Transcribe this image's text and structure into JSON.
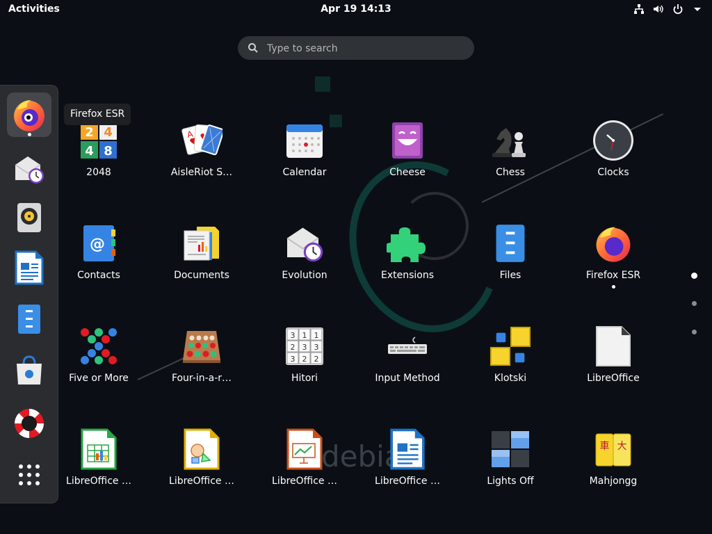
{
  "topbar": {
    "activities": "Activities",
    "clock": "Apr 19  14:13",
    "tray": [
      "network-icon",
      "volume-icon",
      "power-icon",
      "menu-arrow-icon"
    ]
  },
  "search": {
    "placeholder": "Type to search"
  },
  "dash": {
    "items": [
      {
        "name": "firefox-esr",
        "icon": "firefox-icon",
        "active": true,
        "running": true
      },
      {
        "name": "evolution",
        "icon": "evolution-icon"
      },
      {
        "name": "rhythmbox",
        "icon": "rhythmbox-icon"
      },
      {
        "name": "libreoffice-writer",
        "icon": "libreoffice-writer-icon"
      },
      {
        "name": "files",
        "icon": "files-icon"
      },
      {
        "name": "software",
        "icon": "software-icon"
      },
      {
        "name": "help",
        "icon": "help-icon"
      },
      {
        "name": "show-applications",
        "icon": "app-grid-icon"
      }
    ]
  },
  "tooltip": "Firefox ESR",
  "apps": [
    {
      "label": "2048",
      "icon": "2048-icon"
    },
    {
      "label": "AisleRiot S…",
      "icon": "cards-icon"
    },
    {
      "label": "Calendar",
      "icon": "calendar-icon"
    },
    {
      "label": "Cheese",
      "icon": "cheese-icon"
    },
    {
      "label": "Chess",
      "icon": "chess-icon"
    },
    {
      "label": "Clocks",
      "icon": "clocks-icon"
    },
    {
      "label": "Contacts",
      "icon": "contacts-icon"
    },
    {
      "label": "Documents",
      "icon": "documents-icon"
    },
    {
      "label": "Evolution",
      "icon": "evolution-icon"
    },
    {
      "label": "Extensions",
      "icon": "extensions-icon"
    },
    {
      "label": "Files",
      "icon": "files-icon"
    },
    {
      "label": "Firefox ESR",
      "icon": "firefox-icon",
      "running": true
    },
    {
      "label": "Five or More",
      "icon": "five-or-more-icon"
    },
    {
      "label": "Four-in-a-r…",
      "icon": "four-in-a-row-icon"
    },
    {
      "label": "Hitori",
      "icon": "hitori-icon"
    },
    {
      "label": "Input Method",
      "icon": "keyboard-icon"
    },
    {
      "label": "Klotski",
      "icon": "klotski-icon"
    },
    {
      "label": "LibreOffice",
      "icon": "libreoffice-icon"
    },
    {
      "label": "LibreOffice …",
      "icon": "libreoffice-calc-icon"
    },
    {
      "label": "LibreOffice …",
      "icon": "libreoffice-draw-icon"
    },
    {
      "label": "LibreOffice …",
      "icon": "libreoffice-impress-icon"
    },
    {
      "label": "LibreOffice …",
      "icon": "libreoffice-writer-icon"
    },
    {
      "label": "Lights Off",
      "icon": "lights-off-icon"
    },
    {
      "label": "Mahjongg",
      "icon": "mahjongg-icon"
    }
  ],
  "icon_text": {
    "tile_2": "2",
    "tile_4a": "4",
    "tile_4b": "4",
    "tile_8": "8",
    "contacts_at": "@",
    "hitori": [
      "3",
      "1",
      "1",
      "2",
      "3",
      "3",
      "3",
      "2",
      "2"
    ],
    "mahjongg_1": "車",
    "mahjongg_2": "大"
  },
  "pages": {
    "count": 3,
    "current": 0
  },
  "colors": {
    "accent": "#3584e4",
    "dash_bg": "#2a2c30",
    "search_bg": "#2f3236"
  }
}
